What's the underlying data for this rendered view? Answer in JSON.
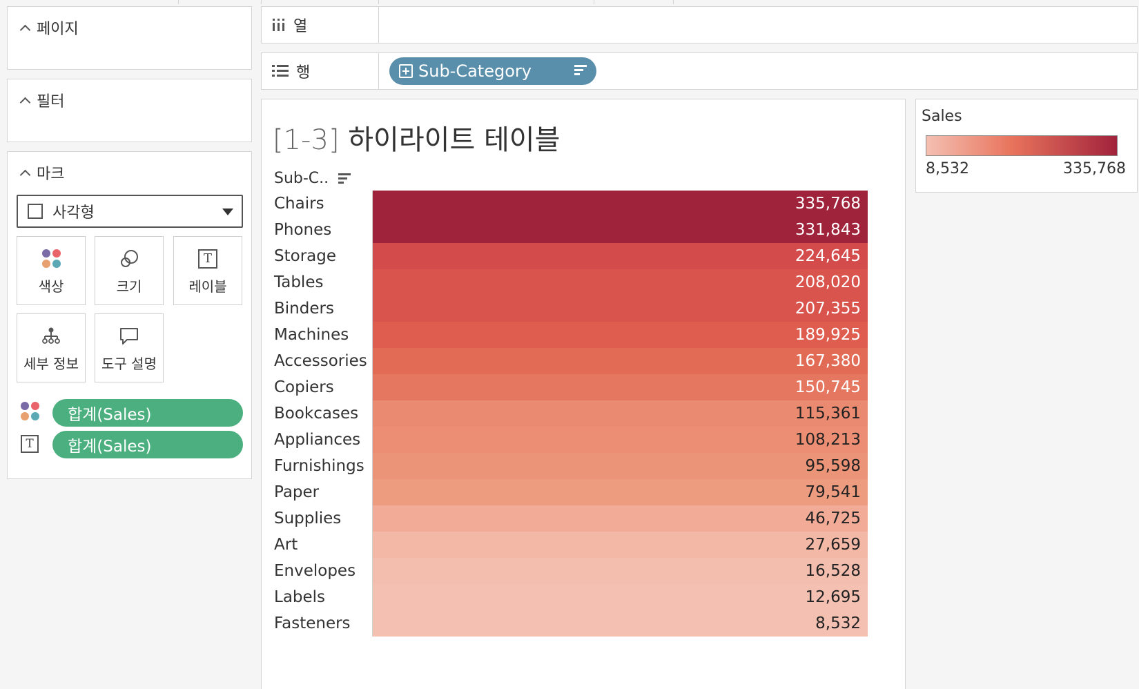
{
  "pages_panel": {
    "title": "페이지"
  },
  "filters_panel": {
    "title": "필터"
  },
  "marks_panel": {
    "title": "마크",
    "mark_type": "사각형",
    "buttons": {
      "color": "색상",
      "size": "크기",
      "label": "레이블",
      "detail": "세부 정보",
      "tooltip": "도구 설명"
    },
    "pills": {
      "color_field": "합계(Sales)",
      "label_field": "합계(Sales)"
    }
  },
  "shelves": {
    "columns_label": "열",
    "rows_label": "행",
    "rows_pill": "Sub-Category"
  },
  "viz": {
    "title_bracket": "[1-3]",
    "title_text": " 하이라이트 테이블",
    "column_header": "Sub-C.."
  },
  "legend": {
    "title": "Sales",
    "min_label": "8,532",
    "max_label": "335,768",
    "color_low": "#f4c0b2",
    "color_high": "#a0233c"
  },
  "chart_data": {
    "type": "table",
    "xlabel": "",
    "ylabel": "Sub-C..",
    "categories": [
      "Chairs",
      "Phones",
      "Storage",
      "Tables",
      "Binders",
      "Machines",
      "Accessories",
      "Copiers",
      "Bookcases",
      "Appliances",
      "Furnishings",
      "Paper",
      "Supplies",
      "Art",
      "Envelopes",
      "Labels",
      "Fasteners"
    ],
    "values": [
      335768,
      331843,
      224645,
      208020,
      207355,
      189925,
      167380,
      150745,
      115361,
      108213,
      95598,
      79541,
      46725,
      27659,
      16528,
      12695,
      8532
    ],
    "labels": [
      "335,768",
      "331,843",
      "224,645",
      "208,020",
      "207,355",
      "189,925",
      "167,380",
      "150,745",
      "115,361",
      "108,213",
      "95,598",
      "79,541",
      "46,725",
      "27,659",
      "16,528",
      "12,695",
      "8,532"
    ],
    "colors": [
      "#a0233c",
      "#a0233c",
      "#d44b4b",
      "#d9544d",
      "#d9544d",
      "#de5d4f",
      "#e26b56",
      "#e5765f",
      "#ea8a70",
      "#eb8e73",
      "#ec9478",
      "#ee9c80",
      "#f1ab96",
      "#f3b8a6",
      "#f4beae",
      "#f4c0b2",
      "#f4c0b2"
    ]
  }
}
